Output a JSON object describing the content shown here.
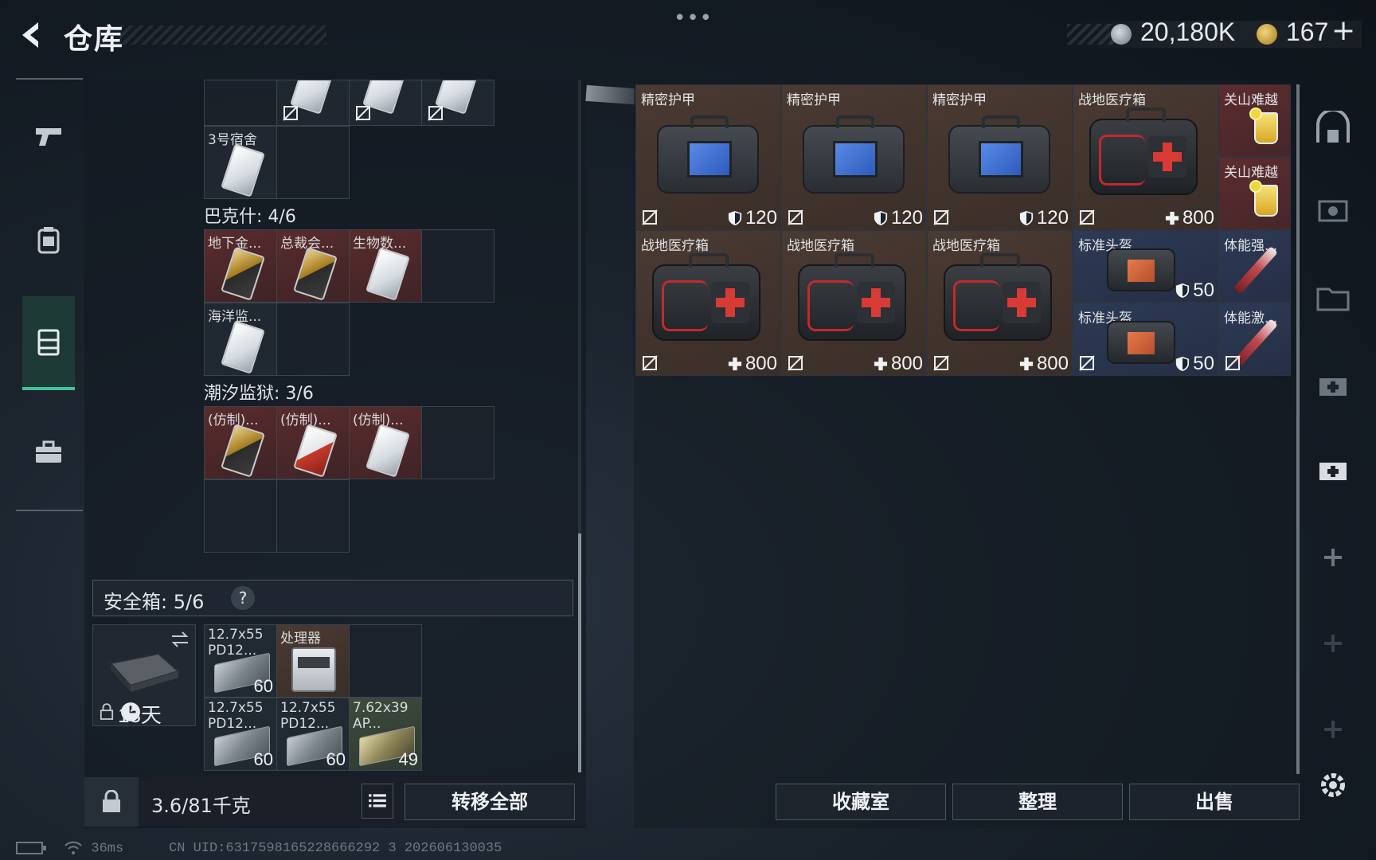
{
  "header": {
    "title": "仓库",
    "money": "20,180K",
    "coupons": "167",
    "coupon_plus": "+",
    "more": "•••"
  },
  "left_nav": {
    "items": [
      {
        "name": "weapon",
        "icon": "pistol-icon"
      },
      {
        "name": "backpack",
        "icon": "backpack-icon"
      },
      {
        "name": "vest",
        "icon": "vest-icon",
        "active": true
      },
      {
        "name": "toolbox",
        "icon": "toolbox-icon"
      }
    ]
  },
  "left_panel": {
    "top_item": {
      "name": "3号宿舍"
    },
    "section_bakeshi": {
      "label": "巴克什: 4/6",
      "items": [
        "地下金...",
        "总裁会...",
        "生物数...",
        "海洋监..."
      ]
    },
    "section_chaoxi": {
      "label": "潮汐监狱: 3/6",
      "items": [
        "(仿制)...",
        "(仿制)...",
        "(仿制)..."
      ]
    },
    "safe_box": {
      "label": "安全箱:  5/6",
      "help": "?",
      "timer": "13天",
      "items": [
        {
          "name": "12.7x55 PD12...",
          "count": "60"
        },
        {
          "name": "处理器",
          "count": ""
        },
        {
          "name": "12.7x55 PD12...",
          "count": "60"
        },
        {
          "name": "12.7x55 PD12...",
          "count": "60"
        },
        {
          "name": "7.62x39 AP...",
          "count": "49"
        }
      ]
    },
    "weight": "3.6/81千克",
    "transfer_all": "转移全部"
  },
  "right_grid": {
    "items": [
      {
        "name": "精密护甲",
        "value": "120"
      },
      {
        "name": "精密护甲",
        "value": "120"
      },
      {
        "name": "精密护甲",
        "value": "120"
      },
      {
        "name": "战地医疗箱",
        "value": "800"
      },
      {
        "name": "关山难越",
        "value": ""
      },
      {
        "name": "关山难越",
        "value": ""
      },
      {
        "name": "战地医疗箱",
        "value": "800"
      },
      {
        "name": "战地医疗箱",
        "value": "800"
      },
      {
        "name": "战地医疗箱",
        "value": "800"
      },
      {
        "name": "标准头盔",
        "value": "50"
      },
      {
        "name": "体能强...",
        "value": ""
      },
      {
        "name": "标准头盔",
        "value": "50"
      },
      {
        "name": "体能激...",
        "value": ""
      }
    ]
  },
  "bottom_buttons": {
    "collection": "收藏室",
    "organize": "整理",
    "sell": "出售"
  },
  "footer": {
    "ping": "36ms",
    "uid": "CN UID:6317598165228666292 3 202606130035"
  },
  "colors": {
    "active_accent": "#3fc49a",
    "rare_red": "#5c2c2e",
    "epic_blue": "#2d3a55",
    "brown_common": "#4a3a32"
  }
}
